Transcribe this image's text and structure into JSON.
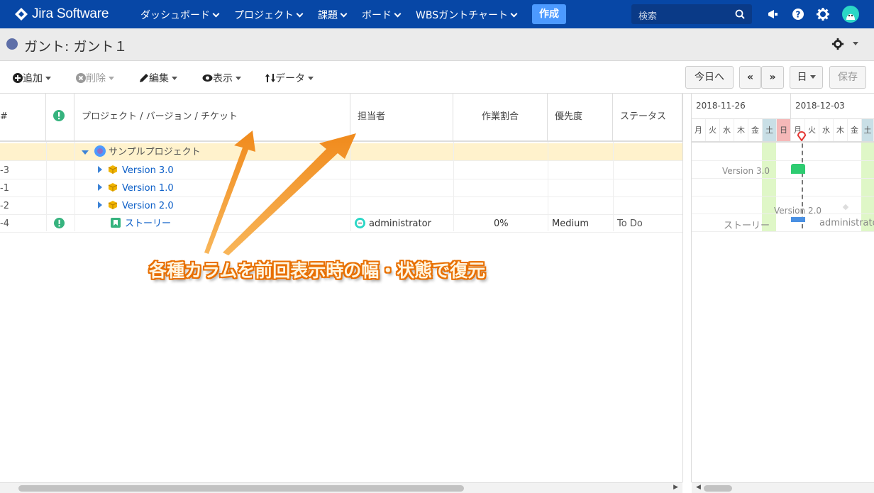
{
  "nav": {
    "brand": "Jira Software",
    "items": [
      {
        "label": "ダッシュボード"
      },
      {
        "label": "プロジェクト"
      },
      {
        "label": "課題"
      },
      {
        "label": "ボード"
      },
      {
        "label": "WBSガントチャート"
      }
    ],
    "create": "作成",
    "search_placeholder": "検索"
  },
  "page": {
    "title": "ガント: ガント１"
  },
  "toolbar": {
    "add": "追加",
    "delete": "削除",
    "edit": "編集",
    "view": "表示",
    "data": "データ",
    "today": "今日へ",
    "prev": "«",
    "next": "»",
    "scale": "日",
    "save": "保存"
  },
  "columns": {
    "key": "#",
    "project": "プロジェクト / バージョン / チケット",
    "assignee": "担当者",
    "progress": "作業割合",
    "priority": "優先度",
    "status": "ステータス"
  },
  "rows": [
    {
      "key": "",
      "name": "サンプルプロジェクト",
      "assignee": "",
      "progress": "",
      "priority": "",
      "status": ""
    },
    {
      "key": "-3",
      "name": "Version 3.0",
      "assignee": "",
      "progress": "",
      "priority": "",
      "status": ""
    },
    {
      "key": "-1",
      "name": "Version 1.0",
      "assignee": "",
      "progress": "",
      "priority": "",
      "status": ""
    },
    {
      "key": "-2",
      "name": "Version 2.0",
      "assignee": "",
      "progress": "",
      "priority": "",
      "status": ""
    },
    {
      "key": "-4",
      "name": "ストーリー",
      "assignee": "administrator",
      "progress": "0%",
      "priority": "Medium",
      "status": "To Do"
    }
  ],
  "gantt": {
    "weeks": [
      "2018-11-26",
      "2018-12-03"
    ],
    "days": [
      "月",
      "火",
      "水",
      "木",
      "金",
      "土",
      "日",
      "月",
      "火",
      "水",
      "木",
      "金",
      "土"
    ],
    "labels": {
      "v3": "Version 3.0",
      "v2": "Version 2.0",
      "story": "ストーリー",
      "assignee": "administrator"
    }
  },
  "annotation": "各種カラムを前回表示時の幅・状態で復元",
  "colors": {
    "nav_bg": "#0747a6",
    "create_btn": "#4c9aff",
    "weekend_green": "#dff7c7",
    "sunday_red": "#f5b8b8",
    "saturday_header": "#c9dfe6",
    "arrow": "#f39a2c",
    "today_line": "#e53935"
  }
}
